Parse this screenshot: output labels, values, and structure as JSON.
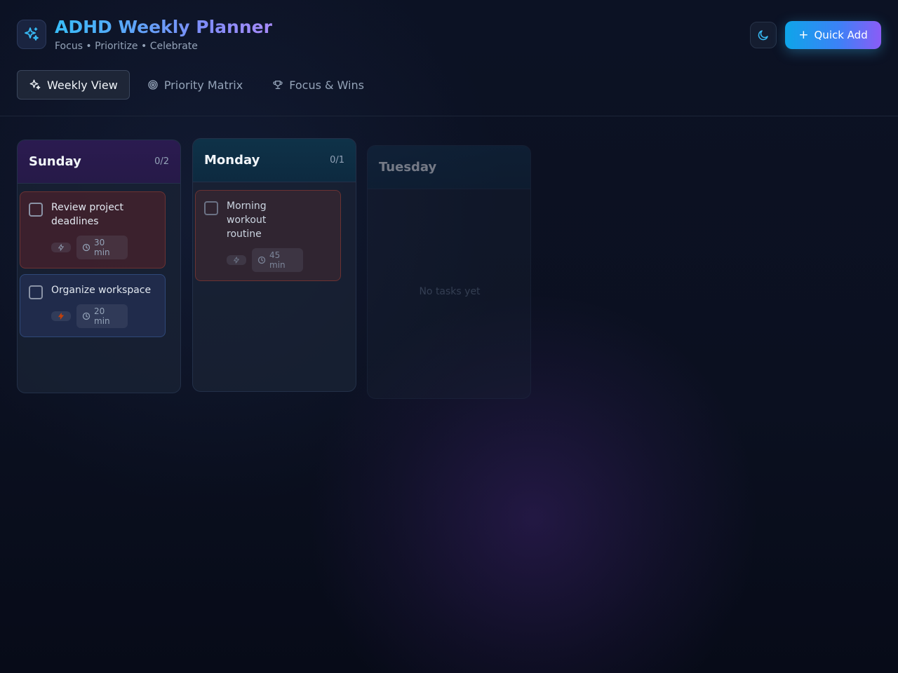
{
  "app": {
    "title": "ADHD Weekly Planner",
    "subtitle": "Focus • Prioritize • Celebrate",
    "logo_icon": "sparkles-icon",
    "theme_icon": "moon-icon",
    "quick_add_label": "Quick Add",
    "quick_add_icon": "plus-icon"
  },
  "colors": {
    "accent_cyan": "#38bdf8",
    "accent_violet": "#8b5cf6",
    "background": "#0b1121"
  },
  "tabs": [
    {
      "label": "Weekly View",
      "icon": "sparkles-icon",
      "active": true
    },
    {
      "label": "Priority Matrix",
      "icon": "target-icon",
      "active": false
    },
    {
      "label": "Focus & Wins",
      "icon": "trophy-icon",
      "active": false
    }
  ],
  "days": [
    {
      "name": "Sunday",
      "count": "0/2",
      "tasks": [
        {
          "title": "Review project deadlines",
          "energy_icon": "zap-icon",
          "duration": "30 min",
          "priority": "high"
        },
        {
          "title": "Organize workspace",
          "energy_icon": "zap-icon",
          "duration": "20 min",
          "priority": "medium"
        }
      ]
    },
    {
      "name": "Monday",
      "count": "0/1",
      "tasks": [
        {
          "title": "Morning workout routine",
          "energy_icon": "zap-icon",
          "duration": "45 min",
          "priority": "high"
        }
      ]
    },
    {
      "name": "Tuesday",
      "count": "",
      "tasks": [],
      "empty_text": "No tasks yet"
    }
  ]
}
